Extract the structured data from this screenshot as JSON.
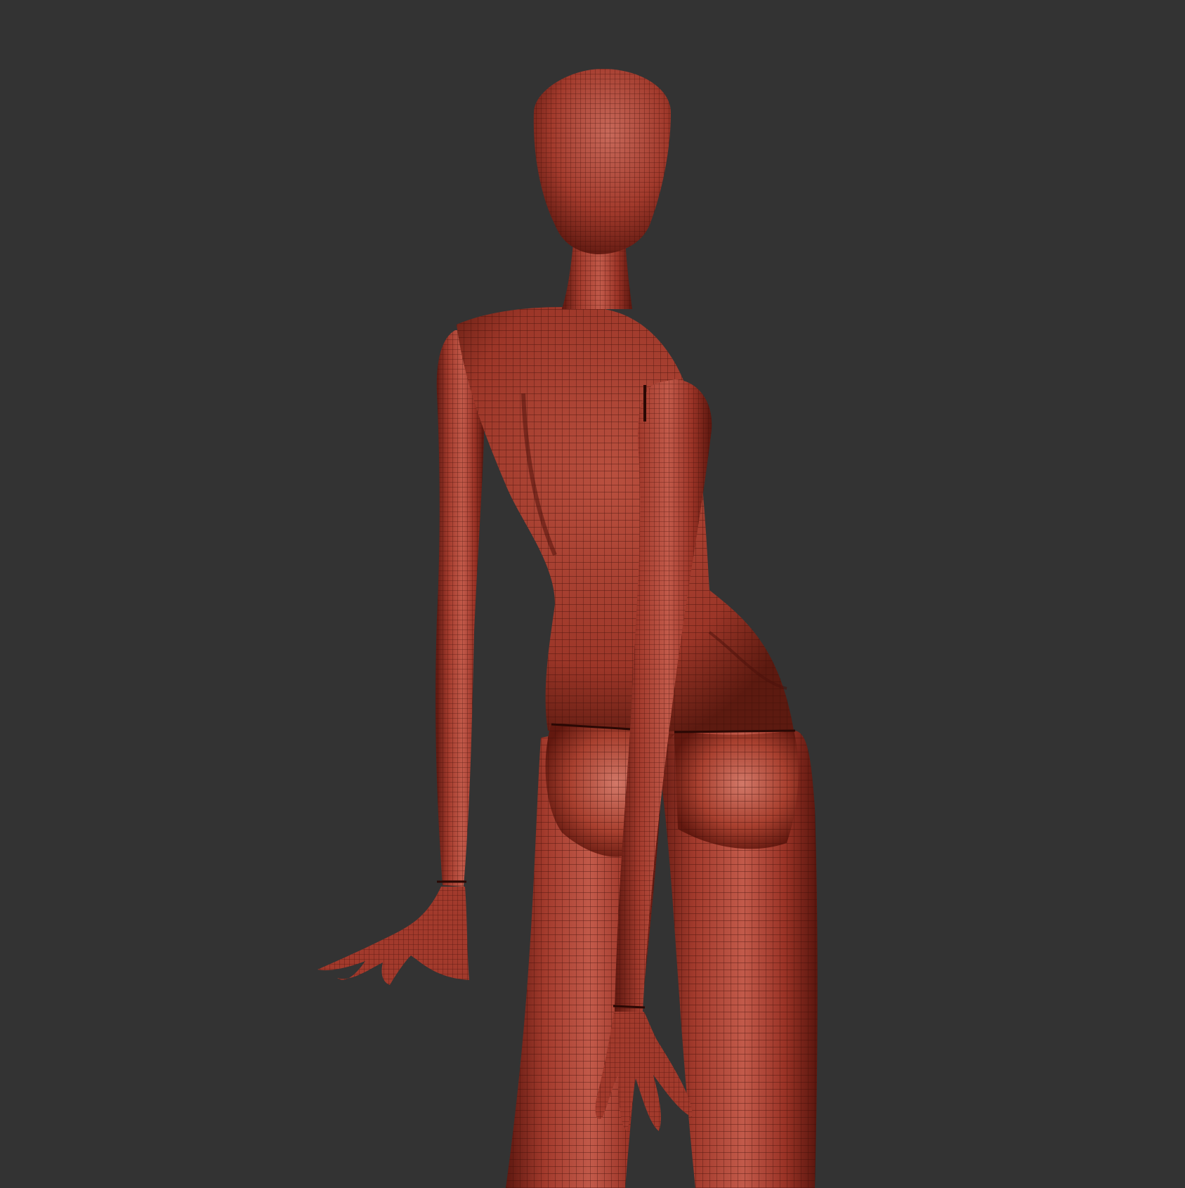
{
  "scene": {
    "background_color": "#333333",
    "mesh_base_color": "#b04030",
    "mesh_shadow_color": "#5e1810",
    "mesh_highlight_color": "#d8776a",
    "wireframe_color": "#3a0c06",
    "seam_color": "#2a0804",
    "subject": "wireframe-mannequin-figure",
    "view": "rear-three-quarter"
  }
}
